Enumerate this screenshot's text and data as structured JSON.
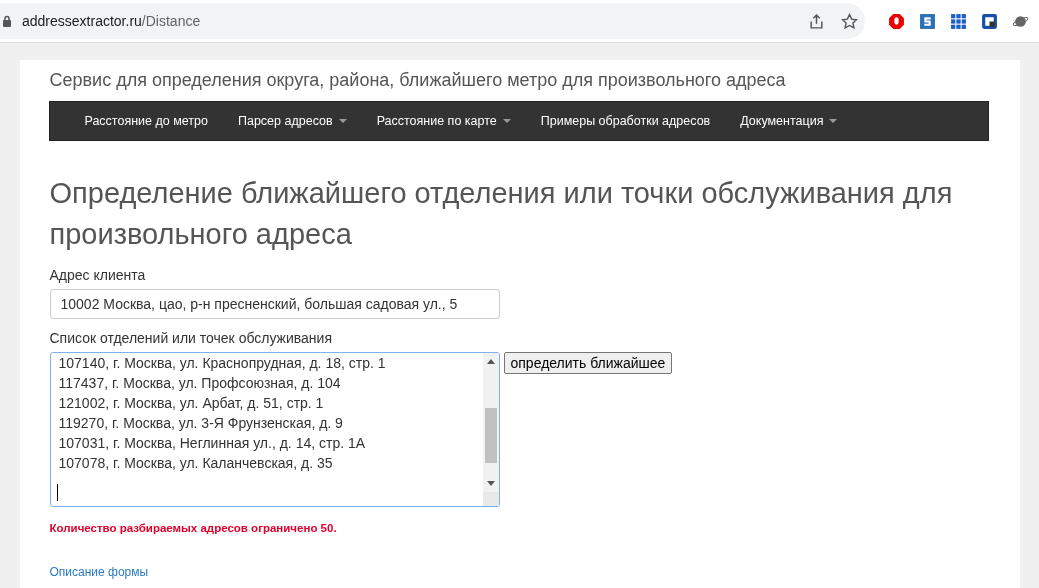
{
  "browser": {
    "url_host": "addressextractor.ru",
    "url_path": "/Distance"
  },
  "site_title": "Сервис для определения округа, района, ближайшего метро для произвольного адреса",
  "nav": [
    {
      "label": "Расстояние до метро",
      "dropdown": false
    },
    {
      "label": "Парсер адресов",
      "dropdown": true
    },
    {
      "label": "Расстояние по карте",
      "dropdown": true
    },
    {
      "label": "Примеры обработки адресов",
      "dropdown": false
    },
    {
      "label": "Документация",
      "dropdown": true
    }
  ],
  "heading": "Определение ближайшего отделения или точки обслуживания для произвольного адреса",
  "client_address": {
    "label": "Адрес клиента",
    "value": "10002 Москва, цао, р-н пресненский, большая садовая ул., 5"
  },
  "points": {
    "label": "Список отделений или точек обслуживания",
    "lines": [
      "107140, г. Москва, ул. Краснопрудная, д. 18, стр. 1",
      "117437, г. Москва, ул. Профсоюзная, д. 104",
      "121002, г. Москва, ул. Арбат, д. 51, стр. 1",
      "119270, г. Москва, ул. 3-Я Фрунзенская, д. 9",
      "107031, г. Москва, Неглинная ул., д. 14, стр. 1А",
      "107078, г. Москва, ул. Каланчевская, д. 35"
    ]
  },
  "submit_button": "определить ближайшее",
  "limit_note": "Количество разбираемых адресов ограничено 50.",
  "form_link": "Описание формы"
}
